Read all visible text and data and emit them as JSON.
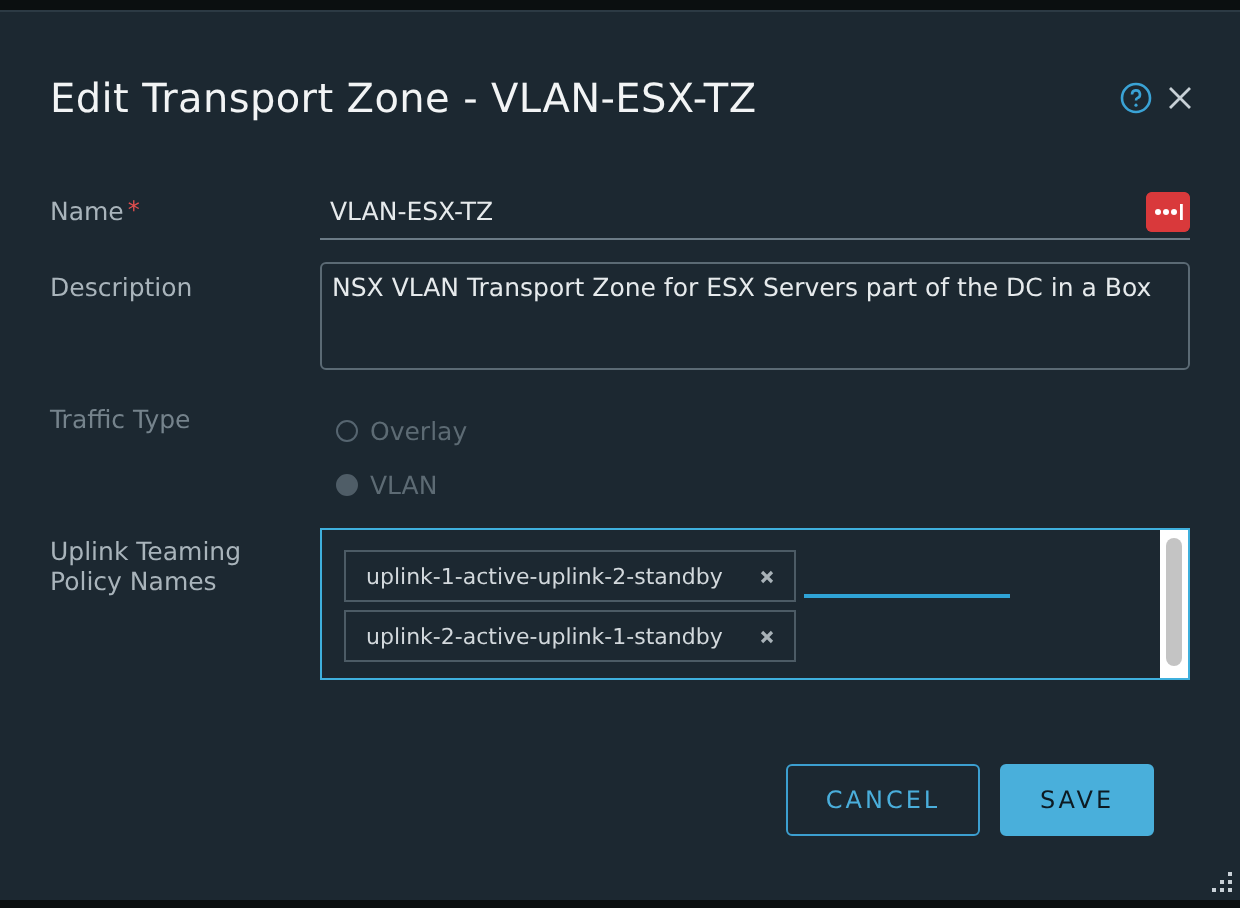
{
  "dialog": {
    "title": "Edit Transport Zone - VLAN-ESX-TZ"
  },
  "name": {
    "label": "Name",
    "required_mark": "*",
    "value": "VLAN-ESX-TZ"
  },
  "description": {
    "label": "Description",
    "value": "NSX VLAN Transport Zone for ESX Servers part of the DC in a Box"
  },
  "traffic_type": {
    "label": "Traffic Type",
    "disabled": true,
    "options": [
      {
        "label": "Overlay",
        "selected": false
      },
      {
        "label": "VLAN",
        "selected": true
      }
    ]
  },
  "uplink_teaming": {
    "label": "Uplink Teaming Policy Names",
    "tags": [
      {
        "label": "uplink-1-active-uplink-2-standby"
      },
      {
        "label": "uplink-2-active-uplink-1-standby"
      }
    ]
  },
  "buttons": [
    {
      "label": "CANCEL",
      "kind": "outline"
    },
    {
      "label": "SAVE",
      "kind": "primary"
    }
  ]
}
